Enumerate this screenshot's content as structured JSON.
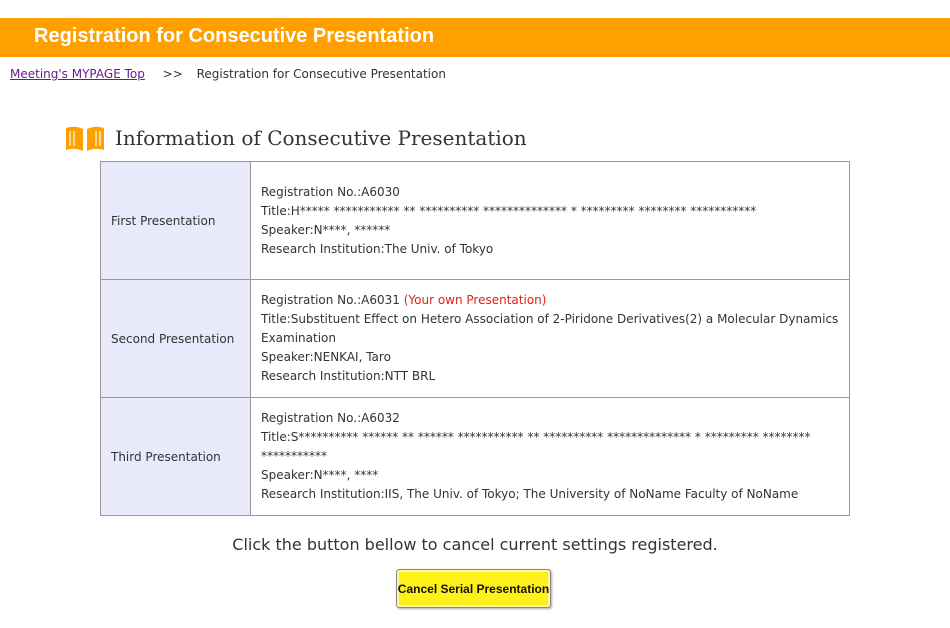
{
  "header": {
    "title": "Registration for Consecutive Presentation"
  },
  "breadcrumb": {
    "top_link": "Meeting's MYPAGE Top",
    "separator": ">>",
    "current": "Registration for Consecutive Presentation"
  },
  "section": {
    "title": "Information of Consecutive Presentation",
    "icon": "book-icon",
    "icon_color": "#ff9f00"
  },
  "presentations": [
    {
      "label": "First Presentation",
      "registration": "Registration No.:A6030",
      "own_note": "",
      "title": "Title:H***** *********** ** ********** ************** * ********* ******** ***********",
      "speaker": "Speaker:N****, ******",
      "institution": "Research Institution:The Univ. of Tokyo"
    },
    {
      "label": "Second Presentation",
      "registration": "Registration No.:A6031",
      "own_note": "(Your own Presentation)",
      "title": "Title:Substituent Effect on Hetero Association of 2-Piridone Derivatives(2) a Molecular Dynamics Examination",
      "speaker": "Speaker:NENKAI, Taro",
      "institution": "Research Institution:NTT BRL"
    },
    {
      "label": "Third Presentation",
      "registration": "Registration No.:A6032",
      "own_note": "",
      "title": "Title:S********** ****** ** ****** *********** ** ********** ************** * ********* ******** ***********",
      "speaker": "Speaker:N****, ****",
      "institution": "Research Institution:IIS, The Univ. of Tokyo; The University of NoName Faculty of NoName"
    }
  ],
  "notice": "Click the button bellow to cancel current settings registered.",
  "cancel_button": "Cancel Serial Presentation",
  "colors": {
    "header": "#ff9f00",
    "label_cell": "#e8e9fa",
    "own_note": "#e0201e",
    "button": "#ffef1a"
  }
}
